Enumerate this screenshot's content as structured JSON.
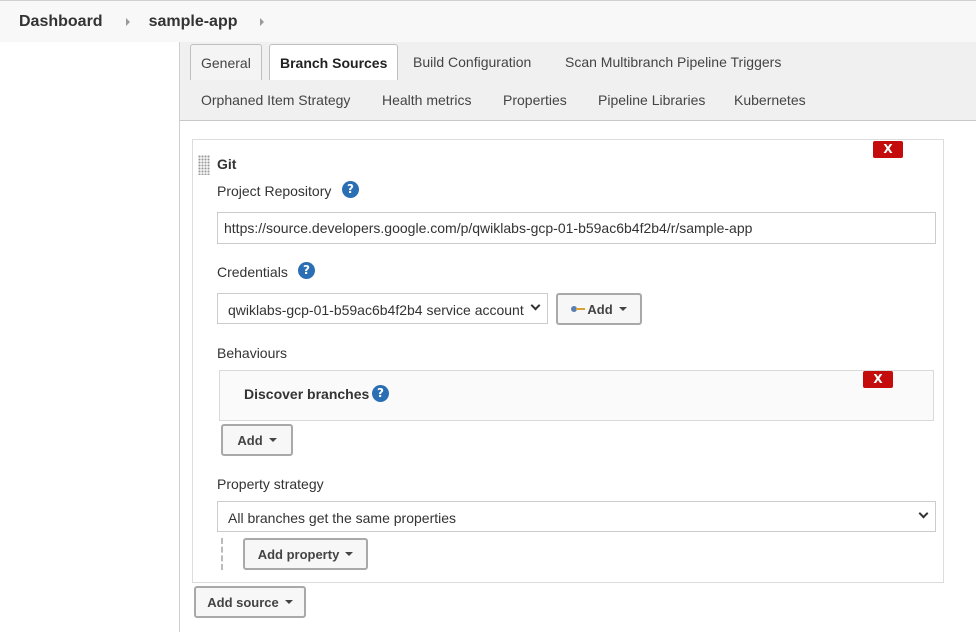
{
  "breadcrumb": {
    "items": [
      {
        "label": "Dashboard"
      },
      {
        "label": "sample-app"
      }
    ]
  },
  "tabs": {
    "row1": [
      {
        "label": "General"
      },
      {
        "label": "Branch Sources"
      },
      {
        "label": "Build Configuration"
      },
      {
        "label": "Scan Multibranch Pipeline Triggers"
      }
    ],
    "row2": [
      {
        "label": "Orphaned Item Strategy"
      },
      {
        "label": "Health metrics"
      },
      {
        "label": "Properties"
      },
      {
        "label": "Pipeline Libraries"
      },
      {
        "label": "Kubernetes"
      }
    ]
  },
  "source": {
    "title": "Git",
    "delete_label": "X",
    "repo_label": "Project Repository",
    "repo_value": "https://source.developers.google.com/p/qwiklabs-gcp-01-b59ac6b4f2b4/r/sample-app",
    "credentials_label": "Credentials",
    "credentials_value": "qwiklabs-gcp-01-b59ac6b4f2b4 service account",
    "credentials_add_label": "Add",
    "behaviours_label": "Behaviours",
    "discover_branches_label": "Discover branches",
    "behaviour_delete_label": "X",
    "behaviour_add_label": "Add",
    "property_strategy_label": "Property strategy",
    "property_strategy_value": "All branches get the same properties",
    "add_property_label": "Add property",
    "help_glyph": "?"
  },
  "add_source_label": "Add source",
  "colors": {
    "accent_red": "#c40c0c",
    "help_blue": "#2a6fb4"
  }
}
